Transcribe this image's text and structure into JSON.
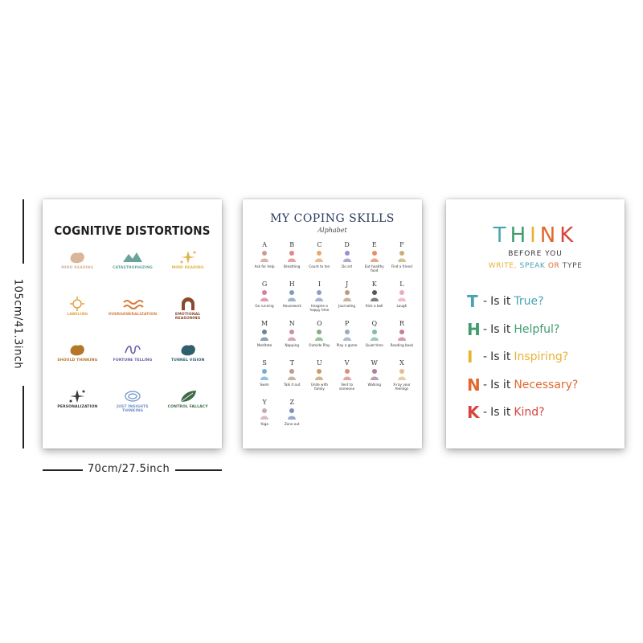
{
  "dimensions": {
    "height_label": "105cm/41.3inch",
    "width_label": "70cm/27.5inch"
  },
  "poster1": {
    "title": "COGNITIVE DISTORTIONS",
    "items": [
      {
        "name": "MIND READING",
        "desc": "",
        "color": "#d9b59a",
        "icon": "blob"
      },
      {
        "name": "CATASTROPHIZING",
        "desc": "",
        "color": "#6aa39c",
        "icon": "mountains"
      },
      {
        "name": "MIND READING",
        "desc": "",
        "color": "#e0b54b",
        "icon": "sparkles"
      },
      {
        "name": "LABELING",
        "desc": "",
        "color": "#e3a03c",
        "icon": "sun"
      },
      {
        "name": "OVERGENERALIZATION",
        "desc": "",
        "color": "#d97a3a",
        "icon": "waves"
      },
      {
        "name": "EMOTIONAL REASONING",
        "desc": "",
        "color": "#8a4a2e",
        "icon": "arch"
      },
      {
        "name": "SHOULD THINKING",
        "desc": "",
        "color": "#b5762a",
        "icon": "blob"
      },
      {
        "name": "FORTUNE TELLING",
        "desc": "",
        "color": "#6b5aa8",
        "icon": "squiggle"
      },
      {
        "name": "TUNNEL VISION",
        "desc": "",
        "color": "#2f5e6e",
        "icon": "blob"
      },
      {
        "name": "PERSONALIZATION",
        "desc": "",
        "color": "#3a3a3a",
        "icon": "sparkles"
      },
      {
        "name": "JUST INSIGHTS THINKING",
        "desc": "",
        "color": "#6a8fc8",
        "icon": "loop"
      },
      {
        "name": "CONTROL FALLACY",
        "desc": "",
        "color": "#3e6b45",
        "icon": "leaf"
      }
    ]
  },
  "poster2": {
    "title": "MY COPING SKILLS",
    "subtitle": "Alphabet",
    "items": [
      {
        "letter": "A",
        "label": "Ask for help",
        "color": "#c98a7a"
      },
      {
        "letter": "B",
        "label": "Breathing",
        "color": "#d9707a"
      },
      {
        "letter": "C",
        "label": "Count to ten",
        "color": "#e09a5a"
      },
      {
        "letter": "D",
        "label": "Do art",
        "color": "#8a7ac0"
      },
      {
        "letter": "E",
        "label": "Eat healthy food",
        "color": "#e07a4a"
      },
      {
        "letter": "F",
        "label": "Find a friend",
        "color": "#c0a060"
      },
      {
        "letter": "G",
        "label": "Go running",
        "color": "#d06a8a"
      },
      {
        "letter": "H",
        "label": "Housework",
        "color": "#6a8ab0"
      },
      {
        "letter": "I",
        "label": "Imagine a happy time",
        "color": "#7a8ac0"
      },
      {
        "letter": "J",
        "label": "Journaling",
        "color": "#b08a6a"
      },
      {
        "letter": "K",
        "label": "Kick a ball",
        "color": "#3a3a3a"
      },
      {
        "letter": "L",
        "label": "Laugh",
        "color": "#e0a0b0"
      },
      {
        "letter": "M",
        "label": "Meditate",
        "color": "#5a6a8a"
      },
      {
        "letter": "N",
        "label": "Napping",
        "color": "#c07a9a"
      },
      {
        "letter": "O",
        "label": "Outside Play",
        "color": "#6aa06a"
      },
      {
        "letter": "P",
        "label": "Play a game",
        "color": "#8a9ac0"
      },
      {
        "letter": "Q",
        "label": "Quiet time",
        "color": "#6ab0a0"
      },
      {
        "letter": "R",
        "label": "Reading book",
        "color": "#c06a7a"
      },
      {
        "letter": "S",
        "label": "Swim",
        "color": "#5aa0d0"
      },
      {
        "letter": "T",
        "label": "Talk it out",
        "color": "#b08a7a"
      },
      {
        "letter": "U",
        "label": "Unite with family",
        "color": "#c08a4a"
      },
      {
        "letter": "V",
        "label": "Vent to someone",
        "color": "#d07a6a"
      },
      {
        "letter": "W",
        "label": "Walking",
        "color": "#a06a8a"
      },
      {
        "letter": "X",
        "label": "X-ray your feelings",
        "color": "#e0b07a"
      },
      {
        "letter": "Y",
        "label": "Yoga",
        "color": "#c09ab0"
      },
      {
        "letter": "Z",
        "label": "Zone out",
        "color": "#6a7ab0"
      }
    ]
  },
  "poster3": {
    "think_letters": [
      {
        "ch": "T",
        "color": "#4aa3b5"
      },
      {
        "ch": "H",
        "color": "#3e9c6e"
      },
      {
        "ch": "I",
        "color": "#e8b132"
      },
      {
        "ch": "N",
        "color": "#e0692e"
      },
      {
        "ch": "K",
        "color": "#d6463c"
      }
    ],
    "before_you": "BEFORE YOU",
    "write": "WRITE,",
    "speak": "SPEAK",
    "or": "OR",
    "type": "TYPE",
    "write_color": "#e8b132",
    "speak_color": "#4aa3b5",
    "or_color": "#e0692e",
    "type_color": "#555555",
    "items": [
      {
        "letter": "T",
        "word": "True?",
        "color": "#4aa3b5"
      },
      {
        "letter": "H",
        "word": "Helpful?",
        "color": "#3e9c6e"
      },
      {
        "letter": "I",
        "word": "Inspiring?",
        "color": "#e8b132"
      },
      {
        "letter": "N",
        "word": "Necessary?",
        "color": "#e0692e"
      },
      {
        "letter": "K",
        "word": "Kind?",
        "color": "#d6463c"
      }
    ],
    "dash": "-",
    "question": "Is it"
  }
}
